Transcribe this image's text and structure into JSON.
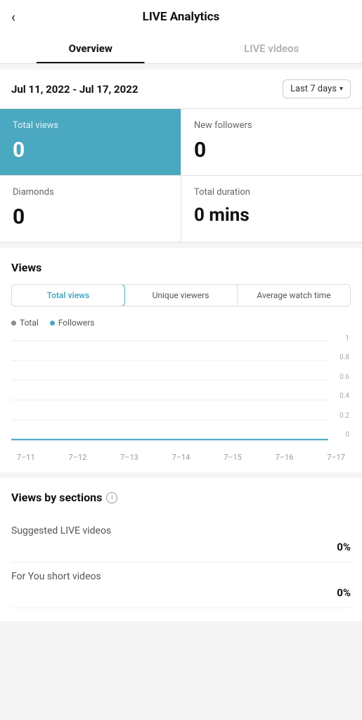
{
  "header": {
    "back_icon": "‹",
    "title": "LIVE Analytics"
  },
  "tabs": [
    {
      "id": "overview",
      "label": "Overview",
      "active": true
    },
    {
      "id": "live-videos",
      "label": "LIVE videos",
      "active": false
    }
  ],
  "date_range": {
    "label": "Jul 11, 2022 - Jul 17, 2022",
    "dropdown_label": "Last 7 days",
    "dropdown_arrow": "▾"
  },
  "stats": [
    {
      "id": "total-views",
      "label": "Total views",
      "value": "0",
      "highlighted": true
    },
    {
      "id": "new-followers",
      "label": "New followers",
      "value": "0",
      "highlighted": false
    },
    {
      "id": "diamonds",
      "label": "Diamonds",
      "value": "0",
      "highlighted": false
    },
    {
      "id": "total-duration",
      "label": "Total duration",
      "value": "0 mins",
      "highlighted": false
    }
  ],
  "chart_section": {
    "title": "Views",
    "tabs": [
      {
        "id": "total-views",
        "label": "Total views",
        "active": true
      },
      {
        "id": "unique-viewers",
        "label": "Unique viewers",
        "active": false
      },
      {
        "id": "avg-watch-time",
        "label": "Average watch time",
        "active": false
      }
    ],
    "legend": [
      {
        "id": "total",
        "label": "Total",
        "color": "#888"
      },
      {
        "id": "followers",
        "label": "Followers",
        "color": "#4aa8c0"
      }
    ],
    "y_labels": [
      "1",
      "0.8",
      "0.6",
      "0.4",
      "0.2",
      "0"
    ],
    "x_labels": [
      "7–11",
      "7–12",
      "7–13",
      "7–14",
      "7–15",
      "7–16",
      "7–17"
    ],
    "chart_color": "#4aa8c0"
  },
  "views_by_sections": {
    "title": "Views by sections",
    "info_icon": "i",
    "rows": [
      {
        "id": "suggested-live",
        "label": "Suggested LIVE videos",
        "value": "0%"
      },
      {
        "id": "for-you-short",
        "label": "For You short videos",
        "value": "0%"
      }
    ]
  }
}
